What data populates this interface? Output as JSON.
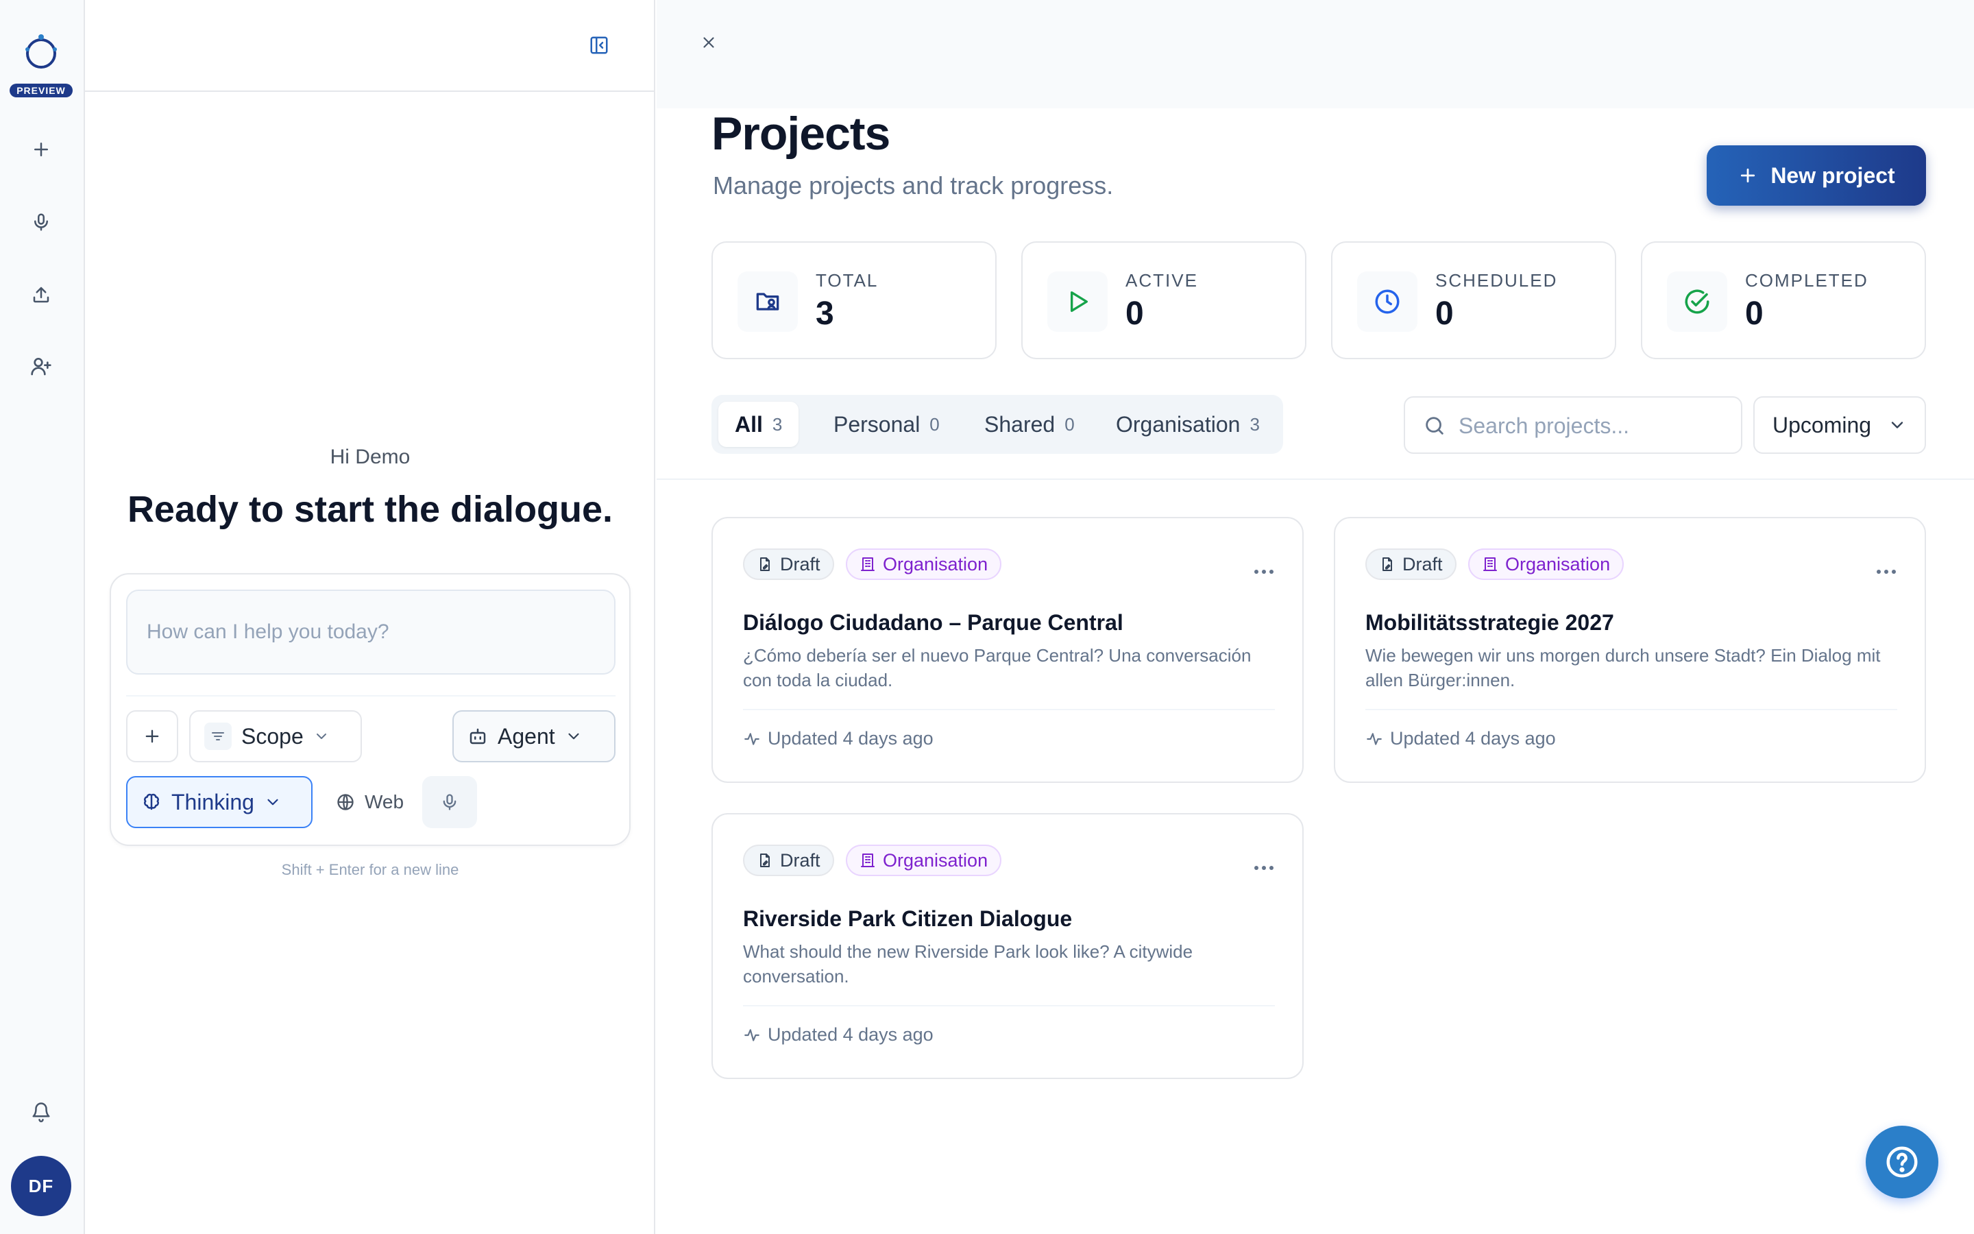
{
  "rail": {
    "badge": "PREVIEW",
    "avatar_initials": "DF"
  },
  "chat": {
    "greeting": "Hi Demo",
    "headline": "Ready to start the dialogue.",
    "input_placeholder": "How can I help you today?",
    "scope_label": "Scope",
    "agent_label": "Agent",
    "thinking_label": "Thinking",
    "web_label": "Web",
    "hint": "Shift + Enter for a new line"
  },
  "projects": {
    "title": "Projects",
    "subtitle": "Manage projects and track progress.",
    "new_button": "New project",
    "stats": [
      {
        "label": "TOTAL",
        "value": "3"
      },
      {
        "label": "ACTIVE",
        "value": "0"
      },
      {
        "label": "SCHEDULED",
        "value": "0"
      },
      {
        "label": "COMPLETED",
        "value": "0"
      }
    ],
    "tabs": [
      {
        "label": "All",
        "count": "3"
      },
      {
        "label": "Personal",
        "count": "0"
      },
      {
        "label": "Shared",
        "count": "0"
      },
      {
        "label": "Organisation",
        "count": "3"
      }
    ],
    "search_placeholder": "Search projects...",
    "sort_label": "Upcoming",
    "cards": [
      {
        "status": "Draft",
        "scope": "Organisation",
        "title": "Diálogo Ciudadano – Parque Central",
        "description": "¿Cómo debería ser el nuevo Parque Central? Una conversación con toda la ciudad.",
        "updated": "Updated 4 days ago"
      },
      {
        "status": "Draft",
        "scope": "Organisation",
        "title": "Mobilitätsstrategie 2027",
        "description": "Wie bewegen wir uns morgen durch unsere Stadt? Ein Dialog mit allen Bürger:innen.",
        "updated": "Updated 4 days ago"
      },
      {
        "status": "Draft",
        "scope": "Organisation",
        "title": "Riverside Park Citizen Dialogue",
        "description": "What should the new Riverside Park look like? A citywide conversation.",
        "updated": "Updated 4 days ago"
      }
    ]
  },
  "colors": {
    "brand": "#1e3a8a",
    "accent": "#2563b8",
    "active": "#16a34a",
    "scheduled": "#2563eb",
    "completed": "#16a34a",
    "organisation": "#7e22ce"
  },
  "icons": {
    "logo": "app-logo-icon",
    "new_chat": "plus-icon",
    "voice": "microphone-icon",
    "upload": "upload-icon",
    "invite": "user-plus-icon",
    "notifications": "bell-icon",
    "help": "help-circle-icon"
  }
}
